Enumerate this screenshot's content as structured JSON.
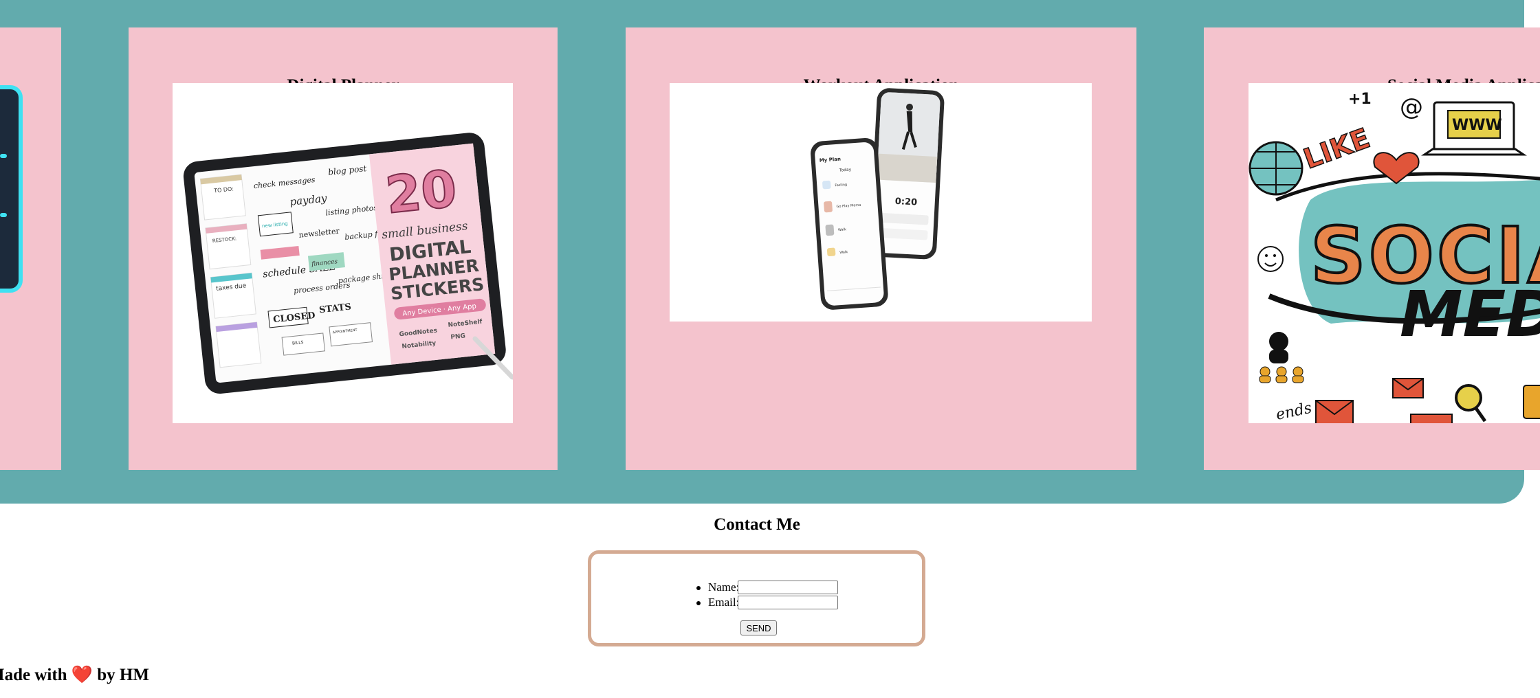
{
  "projects": [
    {
      "title": "",
      "image_icon": "tablet-icon"
    },
    {
      "title": "Digital Planner",
      "image": {
        "big_number": "20",
        "tagline": "small business",
        "headline_1": "DIGITAL",
        "headline_2": "PLANNER",
        "headline_3": "STICKERS",
        "pill": "Any Device · Any App",
        "apps": [
          "GoodNotes",
          "NoteShelf",
          "Notability",
          "PNG"
        ],
        "stickers": [
          "check messages",
          "payday",
          "blog post",
          "new listing",
          "listing photos",
          "newsletter",
          "backup files",
          "schedule SALE",
          "finances",
          "process orders",
          "package ship",
          "CLOSED",
          "STATS",
          "taxes due",
          "TO DO:",
          "RESTOCK:",
          "BILLS",
          "APPOINTMENT"
        ]
      }
    },
    {
      "title": "Workout Application",
      "image": {
        "screen_heading": "My Plan",
        "screen_sub": "Today",
        "timer": "0:20",
        "items": [
          "Fasting",
          "Go Play Mama",
          "Walk",
          "Walk"
        ]
      }
    },
    {
      "title": "Social Media Applicat",
      "image": {
        "words": [
          "LIKE",
          "+1",
          "@",
          "WWW",
          "SOCIA",
          "MED",
          "ends"
        ]
      }
    }
  ],
  "contact": {
    "title": "Contact Me",
    "name_label": "Name:",
    "name_value": "",
    "email_label": "Email:",
    "email_value": "",
    "send_label": "SEND"
  },
  "footer": {
    "prefix": "Made with",
    "heart": "❤️",
    "suffix": "by HM"
  },
  "colors": {
    "band": "#62abad",
    "card": "#f4c3cd",
    "contact_border": "#d4aa92"
  }
}
